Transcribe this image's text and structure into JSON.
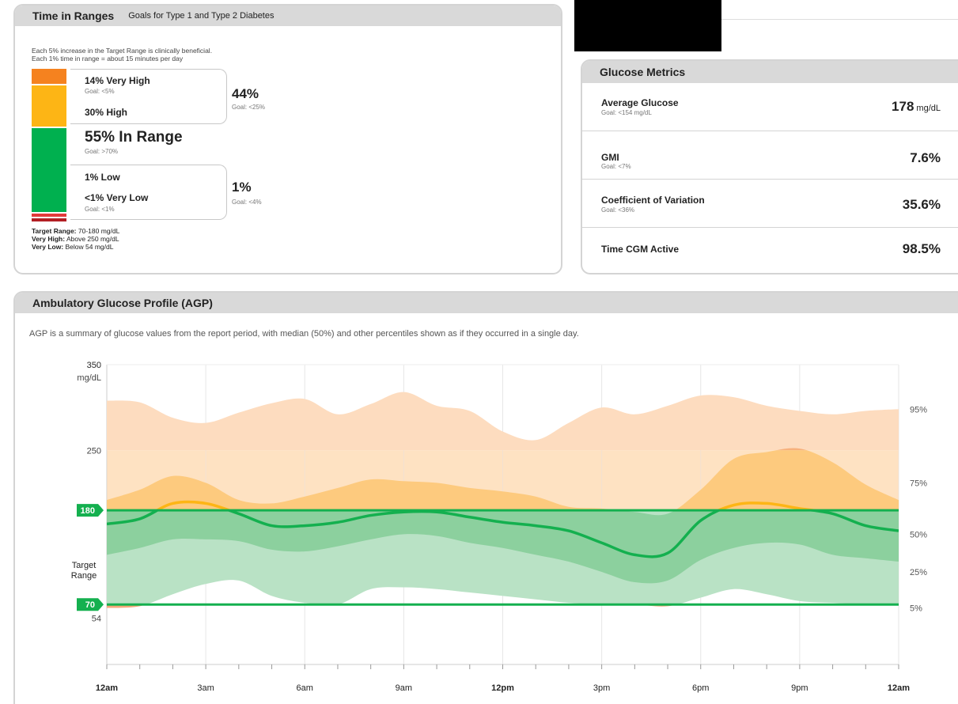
{
  "tir": {
    "title": "Time in Ranges",
    "subtitle": "Goals for Type 1 and Type 2 Diabetes",
    "note1": "Each 5% increase in the Target Range is clinically beneficial.",
    "note2": "Each 1% time in range = about 15 minutes per day",
    "very_high": {
      "label": "14% Very High",
      "goal": "Goal: <5%",
      "percent": 14,
      "color": "#f5821f"
    },
    "high": {
      "label": "30% High",
      "percent": 30,
      "color": "#fdb515"
    },
    "high_total": {
      "value": "44%",
      "goal": "Goal: <25%"
    },
    "in_range": {
      "label": "55% In Range",
      "goal": "Goal: >70%",
      "percent": 55,
      "color": "#00b04f"
    },
    "low": {
      "label": "1% Low",
      "percent": 1,
      "color": "#e23a3a"
    },
    "very_low": {
      "label": "<1% Very Low",
      "goal": "Goal: <1%",
      "percent": 0.5,
      "color": "#b21f24"
    },
    "low_total": {
      "value": "1%",
      "goal": "Goal: <4%"
    },
    "footer": [
      {
        "bold": "Target Range:",
        "text": " 70-180 mg/dL"
      },
      {
        "bold": "Very High:",
        "text": " Above 250 mg/dL"
      },
      {
        "bold": "Very Low:",
        "text": " Below 54 mg/dL"
      }
    ]
  },
  "metrics": {
    "title": "Glucose Metrics",
    "rows": [
      {
        "label": "Average Glucose",
        "goal": "Goal: <154 mg/dL",
        "value": "178",
        "unit": "mg/dL"
      },
      {
        "label": "GMI",
        "goal": "Goal: <7%",
        "value": "7.6%",
        "unit": ""
      },
      {
        "label": "Coefficient of Variation",
        "goal": "Goal: <36%",
        "value": "35.6%",
        "unit": ""
      },
      {
        "label": "Time CGM Active",
        "goal": "",
        "value": "98.5%",
        "unit": ""
      }
    ]
  },
  "agp": {
    "title": "Ambulatory Glucose Profile (AGP)",
    "description": "AGP is a summary of glucose values from the report period, with median (50%) and other percentiles shown as if they occurred in a single day.",
    "y_top_label": "350",
    "y_unit": "mg/dL",
    "target_label_1": "Target",
    "target_label_2": "Range"
  },
  "chart_data": {
    "type": "area",
    "title": "Ambulatory Glucose Profile (AGP)",
    "xlabel": "",
    "ylabel": "mg/dL",
    "ylim": [
      0,
      350
    ],
    "y_ticks": [
      {
        "value": 350,
        "label": "350"
      },
      {
        "value": 250,
        "label": "250"
      },
      {
        "value": 180,
        "label": "180"
      },
      {
        "value": 70,
        "label": "70"
      },
      {
        "value": 54,
        "label": "54"
      }
    ],
    "x_ticks": [
      {
        "hour": 0,
        "label": "12am"
      },
      {
        "hour": 3,
        "label": "3am"
      },
      {
        "hour": 6,
        "label": "6am"
      },
      {
        "hour": 9,
        "label": "9am"
      },
      {
        "hour": 12,
        "label": "12pm"
      },
      {
        "hour": 15,
        "label": "3pm"
      },
      {
        "hour": 18,
        "label": "6pm"
      },
      {
        "hour": 21,
        "label": "9pm"
      },
      {
        "hour": 24,
        "label": "12am"
      }
    ],
    "target_range": [
      70,
      180
    ],
    "hours": [
      0,
      1,
      2,
      3,
      4,
      5,
      6,
      7,
      8,
      9,
      10,
      11,
      12,
      13,
      14,
      15,
      16,
      17,
      18,
      19,
      20,
      21,
      22,
      23,
      24
    ],
    "series": [
      {
        "name": "95%",
        "values": [
          308,
          306,
          288,
          282,
          294,
          305,
          310,
          292,
          304,
          318,
          302,
          296,
          272,
          262,
          282,
          300,
          292,
          302,
          314,
          312,
          302,
          296,
          292,
          296,
          298
        ]
      },
      {
        "name": "75%",
        "values": [
          192,
          204,
          220,
          212,
          192,
          188,
          196,
          206,
          216,
          214,
          212,
          206,
          202,
          196,
          184,
          182,
          178,
          176,
          204,
          240,
          248,
          252,
          236,
          210,
          192
        ]
      },
      {
        "name": "50%",
        "values": [
          164,
          170,
          188,
          188,
          176,
          162,
          162,
          166,
          174,
          178,
          178,
          172,
          166,
          162,
          156,
          142,
          128,
          130,
          168,
          186,
          188,
          182,
          176,
          162,
          156
        ]
      },
      {
        "name": "25%",
        "values": [
          128,
          136,
          146,
          146,
          144,
          134,
          132,
          138,
          146,
          152,
          150,
          142,
          136,
          128,
          120,
          108,
          96,
          98,
          122,
          136,
          142,
          140,
          128,
          124,
          120
        ]
      },
      {
        "name": "5%",
        "values": [
          66,
          68,
          82,
          94,
          98,
          80,
          72,
          70,
          88,
          90,
          88,
          84,
          80,
          76,
          72,
          70,
          70,
          68,
          78,
          88,
          82,
          74,
          72,
          70,
          70
        ]
      }
    ],
    "right_labels": [
      "95%",
      "75%",
      "50%",
      "25%",
      "5%"
    ],
    "colors": {
      "outer_orange": "#fddcbf",
      "above250_band": "#fee9c6",
      "inner_orange": "#fdca7e",
      "inner_dark_orange": "#f7b17c",
      "outer_green": "#b9e2c5",
      "inner_green": "#8cd09e",
      "median_green": "#14b04f",
      "median_orange": "#fdb515",
      "target_line": "#14b04f"
    },
    "grid": true,
    "legend": "right"
  }
}
